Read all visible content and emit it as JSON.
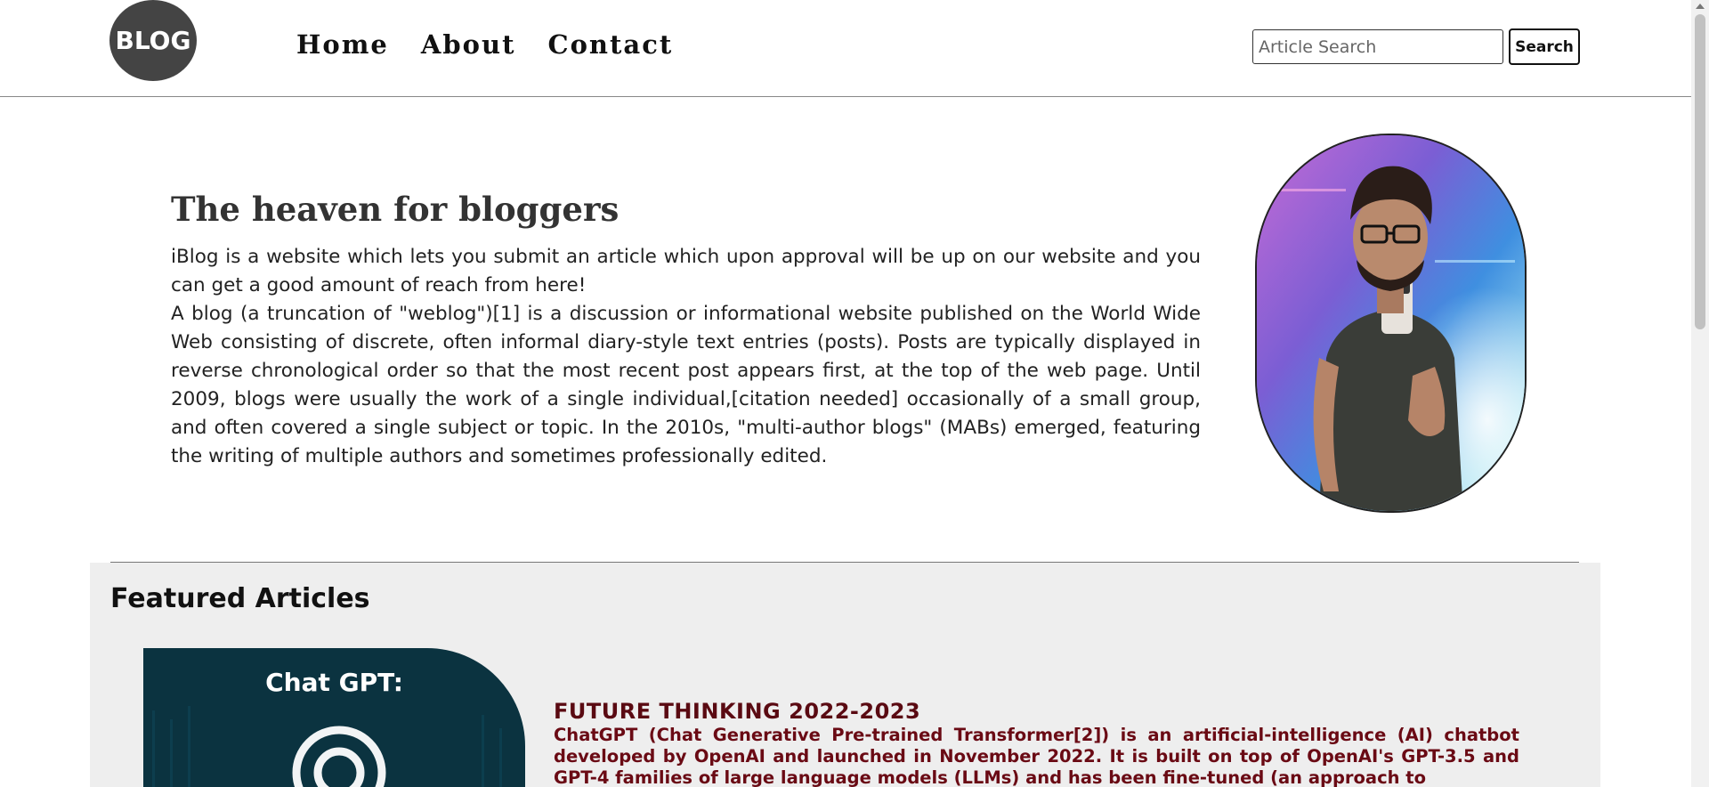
{
  "header": {
    "logo_text": "BLOG",
    "nav": [
      "Home",
      "About",
      "Contact"
    ],
    "search_placeholder": "Article Search",
    "search_button": "Search"
  },
  "hero": {
    "title": "The heaven for bloggers",
    "paragraphs": [
      "iBlog is a website which lets you submit an article which upon approval will be up on our website and you can get a good amount of reach from here!",
      "A blog (a truncation of \"weblog\")[1] is a discussion or informational website published on the World Wide Web consisting of discrete, often informal diary-style text entries (posts). Posts are typically displayed in reverse chronological order so that the most recent post appears first, at the top of the web page. Until 2009, blogs were usually the work of a single individual,[citation needed] occasionally of a small group, and often covered a single subject or topic. In the 2010s, \"multi-author blogs\" (MABs) emerged, featuring the writing of multiple authors and sometimes professionally edited."
    ]
  },
  "featured": {
    "title": "Featured Articles",
    "articles": [
      {
        "image_text": "Chat GPT:",
        "heading": "FUTURE THINKING 2022-2023",
        "body": "ChatGPT (Chat Generative Pre-trained Transformer[2]) is an artificial-intelligence (AI) chatbot developed by OpenAI and launched in November 2022. It is built on top of OpenAI's GPT-3.5 and GPT-4 families of large language models (LLMs) and has been fine-tuned (an approach to"
      }
    ]
  }
}
